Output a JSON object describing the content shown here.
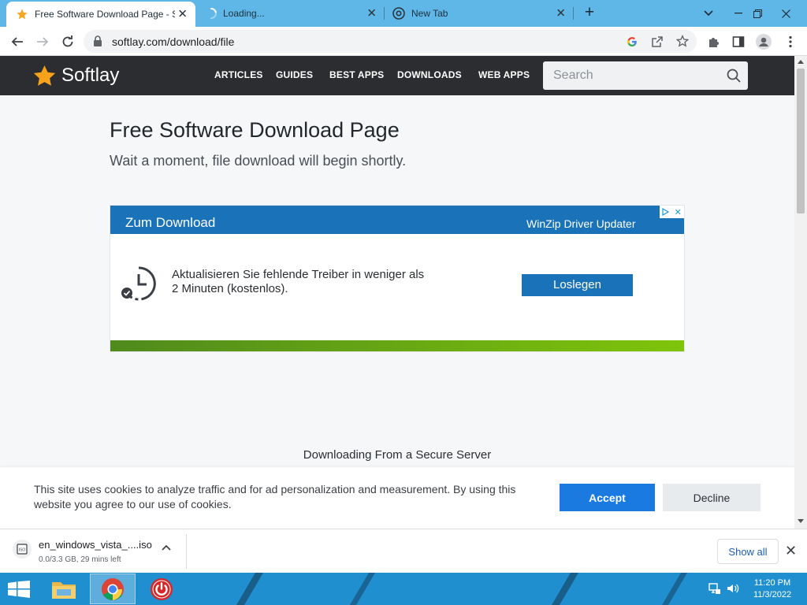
{
  "browser": {
    "tabs": [
      {
        "title": "Free Software Download Page - S",
        "favicon": "star-favicon",
        "active": true
      },
      {
        "title": "Loading...",
        "favicon": "loading-spinner",
        "active": false
      },
      {
        "title": "New Tab",
        "favicon": "chrome-icon",
        "active": false
      }
    ],
    "url": "softlay.com/download/file",
    "accent": "#5fb7e8"
  },
  "site": {
    "logo": "Softlay",
    "nav": [
      "ARTICLES",
      "GUIDES",
      "BEST APPS",
      "DOWNLOADS",
      "WEB APPS"
    ],
    "search_placeholder": "Search",
    "title": "Free Software Download Page",
    "subtitle": "Wait a moment, file download will begin shortly.",
    "secure_text": "Downloading From a Secure Server"
  },
  "ad": {
    "header": "Zum Download",
    "brand": "WinZip Driver Updater",
    "text": "Aktualisieren Sie fehlende Treiber in weniger als 2 Minuten (kostenlos).",
    "button": "Loslegen",
    "color": "#1a72b8"
  },
  "cookie": {
    "text": "This site uses cookies to analyze traffic and for ad personalization and measurement. By using this website you agree to our use of cookies.",
    "accept": "Accept",
    "decline": "Decline"
  },
  "download": {
    "filename": "en_windows_vista_....iso",
    "status": "0.0/3.3 GB, 29 mins left",
    "show_all": "Show all"
  },
  "taskbar": {
    "time": "11:20 PM",
    "date": "11/3/2022"
  }
}
